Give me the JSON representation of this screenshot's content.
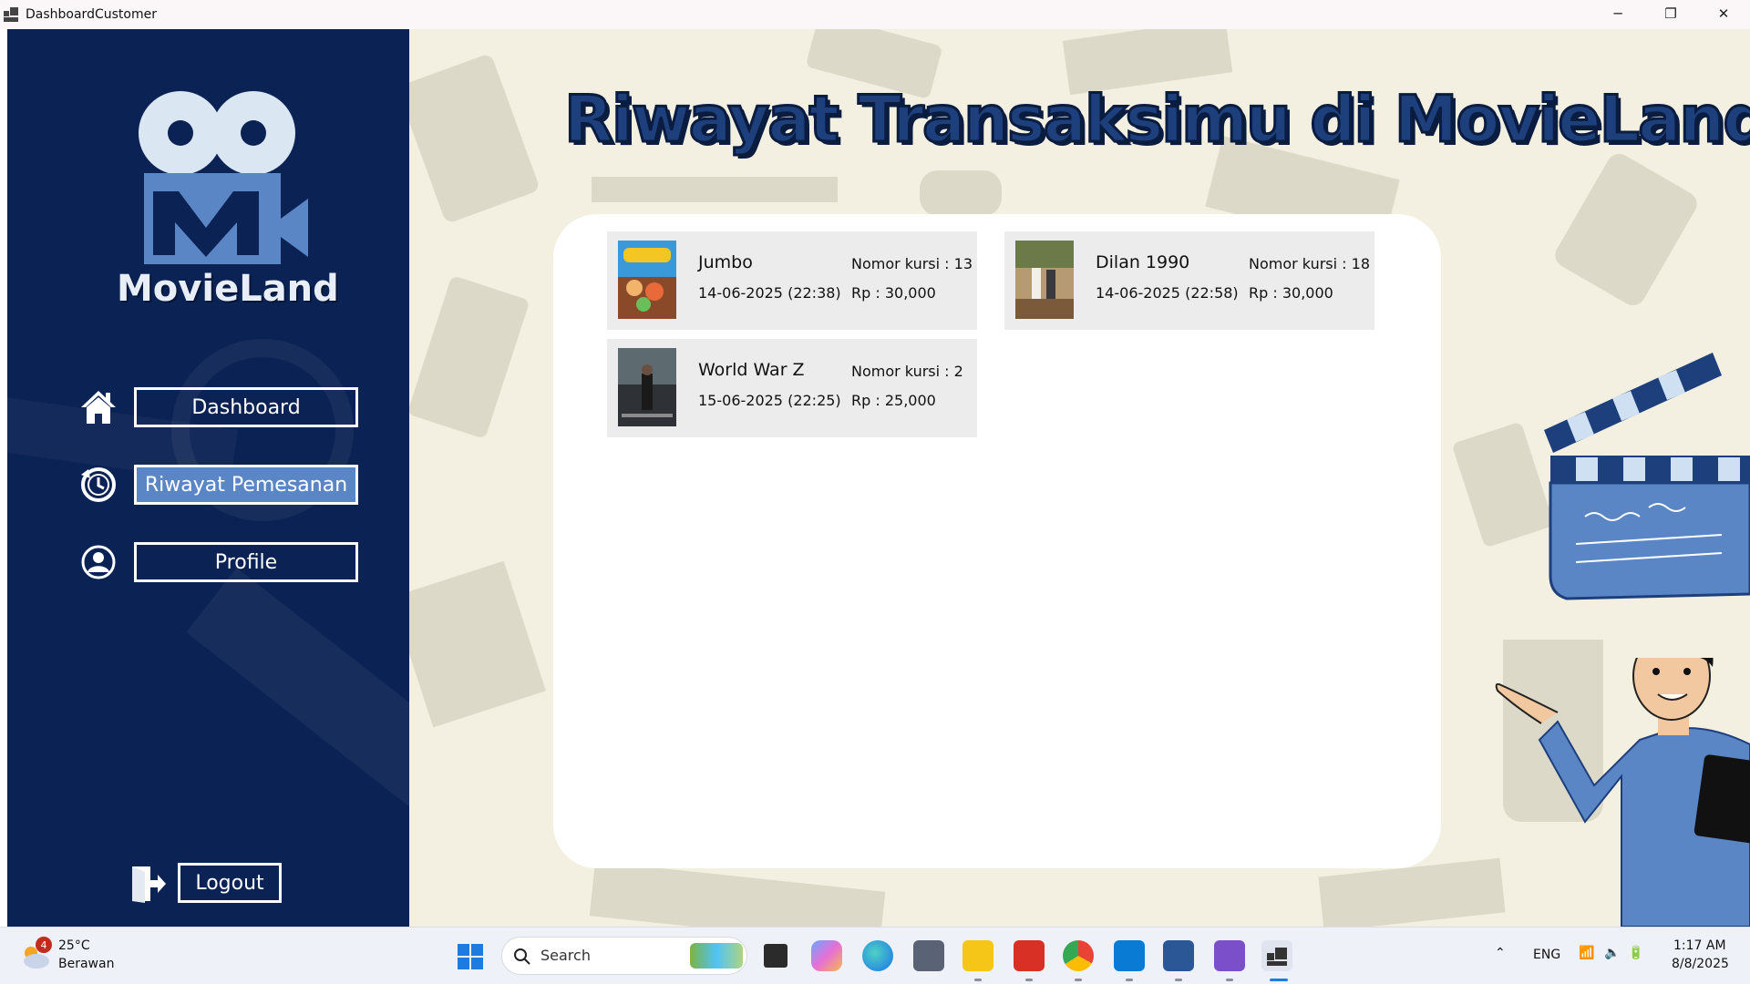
{
  "window": {
    "title": "DashboardCustomer",
    "controls": {
      "minimize": "─",
      "maximize": "❐",
      "close": "✕"
    }
  },
  "sidebar": {
    "logo_text": "MovieLand",
    "nav": [
      {
        "label": "Dashboard",
        "icon": "home-icon",
        "active": false
      },
      {
        "label": "Riwayat Pemesanan",
        "icon": "history-icon",
        "active": true
      },
      {
        "label": "Profile",
        "icon": "user-icon",
        "active": false
      }
    ],
    "logout_label": "Logout",
    "colors": {
      "background": "#0b2254",
      "active": "#5b86c5"
    }
  },
  "main": {
    "heading": "Riwayat Transaksimu di MovieLand",
    "transactions": [
      {
        "title": "Jumbo",
        "datetime": "14-06-2025 (22:38)",
        "seat": "Nomor kursi : 13",
        "price": "Rp : 30,000",
        "poster": "jumbo-poster"
      },
      {
        "title": "Dilan 1990",
        "datetime": "14-06-2025 (22:58)",
        "seat": "Nomor kursi : 18",
        "price": "Rp : 30,000",
        "poster": "dilan-1990-poster"
      },
      {
        "title": "World War Z",
        "datetime": "15-06-2025 (22:25)",
        "seat": "Nomor kursi : 2",
        "price": "Rp : 25,000",
        "poster": "world-war-z-poster"
      }
    ]
  },
  "taskbar": {
    "weather": {
      "badge": "4",
      "temperature": "25°C",
      "condition": "Berawan"
    },
    "search_placeholder": "Search",
    "language": "ENG",
    "time": "1:17 AM",
    "date": "8/8/2025"
  }
}
